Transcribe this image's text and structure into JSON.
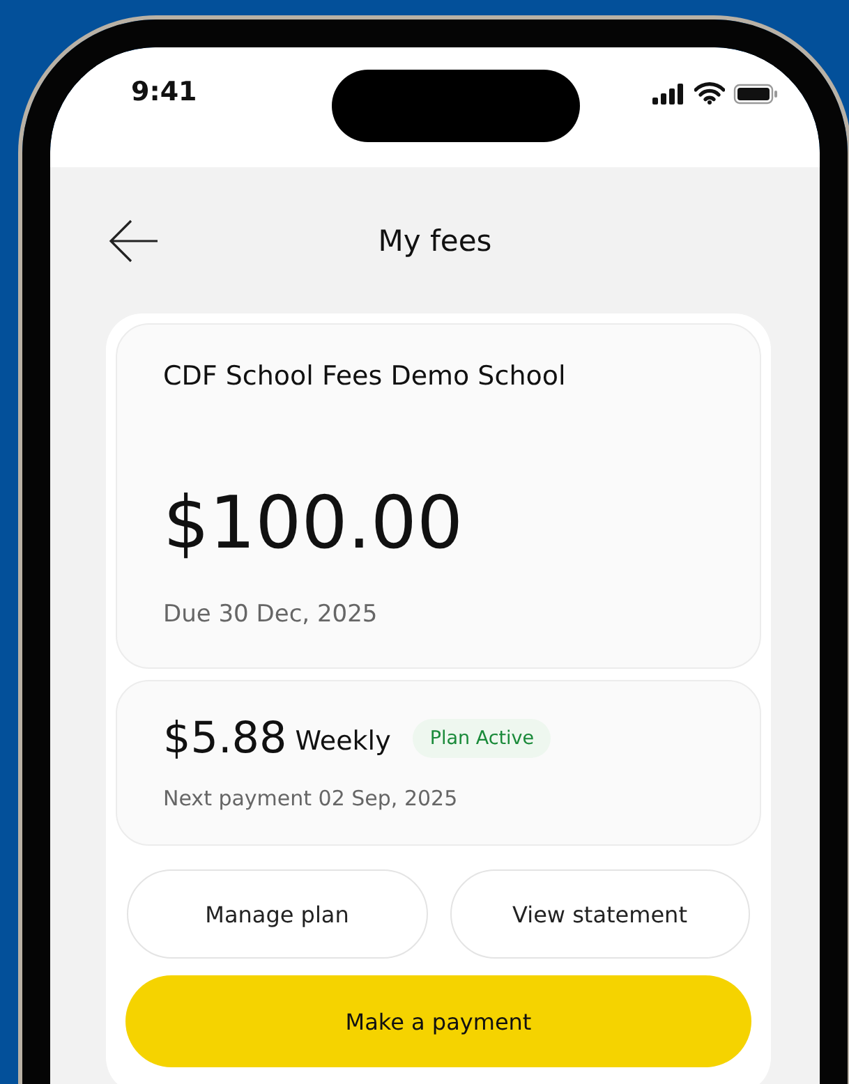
{
  "status_bar": {
    "time": "9:41"
  },
  "header": {
    "title": "My fees"
  },
  "fee": {
    "school": "CDF School Fees Demo School",
    "amount": "$100.00",
    "due": "Due 30 Dec, 2025"
  },
  "plan": {
    "amount": "$5.88",
    "frequency": "Weekly",
    "status": {
      "label": "Plan Active",
      "active": true
    },
    "next_payment": "Next payment 02 Sep, 2025"
  },
  "buttons": [
    {
      "label": "Manage plan",
      "kind": "outline"
    },
    {
      "label": "View statement",
      "kind": "outline"
    },
    {
      "label": "Make a payment",
      "kind": "primary"
    }
  ]
}
